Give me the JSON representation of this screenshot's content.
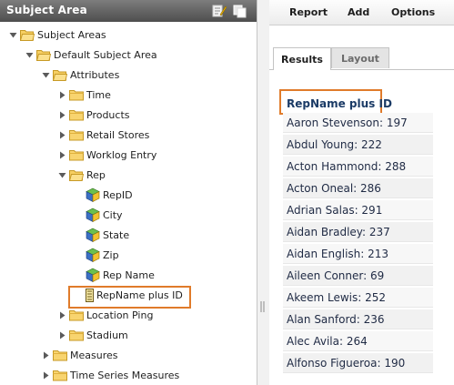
{
  "left_panel": {
    "title": "Subject Area",
    "tree": [
      {
        "label": "Subject Areas",
        "icon": "folder-open-icon",
        "toggle": "expanded",
        "level": 0
      },
      {
        "label": "Default Subject Area",
        "icon": "folder-open-icon",
        "toggle": "expanded",
        "level": 1
      },
      {
        "label": "Attributes",
        "icon": "folder-open-icon",
        "toggle": "expanded",
        "level": 2
      },
      {
        "label": "Time",
        "icon": "folder-icon",
        "toggle": "collapsed",
        "level": 3
      },
      {
        "label": "Products",
        "icon": "folder-icon",
        "toggle": "collapsed",
        "level": 3
      },
      {
        "label": "Retail Stores",
        "icon": "folder-icon",
        "toggle": "collapsed",
        "level": 3
      },
      {
        "label": "Worklog Entry",
        "icon": "folder-icon",
        "toggle": "collapsed",
        "level": 3
      },
      {
        "label": "Rep",
        "icon": "folder-open-icon",
        "toggle": "expanded",
        "level": 3
      },
      {
        "label": "RepID",
        "icon": "attribute-cube-icon",
        "toggle": "none",
        "level": 4
      },
      {
        "label": "City",
        "icon": "attribute-cube-icon",
        "toggle": "none",
        "level": 4
      },
      {
        "label": "State",
        "icon": "attribute-cube-icon",
        "toggle": "none",
        "level": 4
      },
      {
        "label": "Zip",
        "icon": "attribute-cube-icon",
        "toggle": "none",
        "level": 4
      },
      {
        "label": "Rep Name",
        "icon": "attribute-cube-icon",
        "toggle": "none",
        "level": 4
      },
      {
        "label": "RepName plus ID",
        "icon": "calculated-column-icon",
        "toggle": "none",
        "level": 4
      },
      {
        "label": "Location Ping",
        "icon": "folder-icon",
        "toggle": "collapsed",
        "level": 3
      },
      {
        "label": "Stadium",
        "icon": "folder-icon",
        "toggle": "collapsed",
        "level": 3
      },
      {
        "label": "Measures",
        "icon": "folder-icon",
        "toggle": "collapsed",
        "level": 2
      },
      {
        "label": "Time Series Measures",
        "icon": "folder-icon",
        "toggle": "collapsed",
        "level": 2
      }
    ]
  },
  "toolbar": {
    "report_label": "Report",
    "add_label": "Add",
    "options_label": "Options"
  },
  "tabs": [
    {
      "label": "Results",
      "active": true
    },
    {
      "label": "Layout",
      "active": false
    }
  ],
  "results": {
    "column_header": "RepName plus ID",
    "rows": [
      "Aaron Stevenson: 197",
      "Abdul Young: 222",
      "Acton Hammond: 288",
      "Acton Oneal: 286",
      "Adrian Salas: 291",
      "Aidan Bradley: 237",
      "Aidan English: 213",
      "Aileen Conner: 69",
      "Akeem Lewis: 252",
      "Alan Sanford: 236",
      "Alec Avila: 264",
      "Alfonso Figueroa: 190"
    ]
  },
  "colors": {
    "highlight": "#e07b2a",
    "header_dark": "#4e4e4e",
    "column_header_text": "#1b3b66"
  }
}
